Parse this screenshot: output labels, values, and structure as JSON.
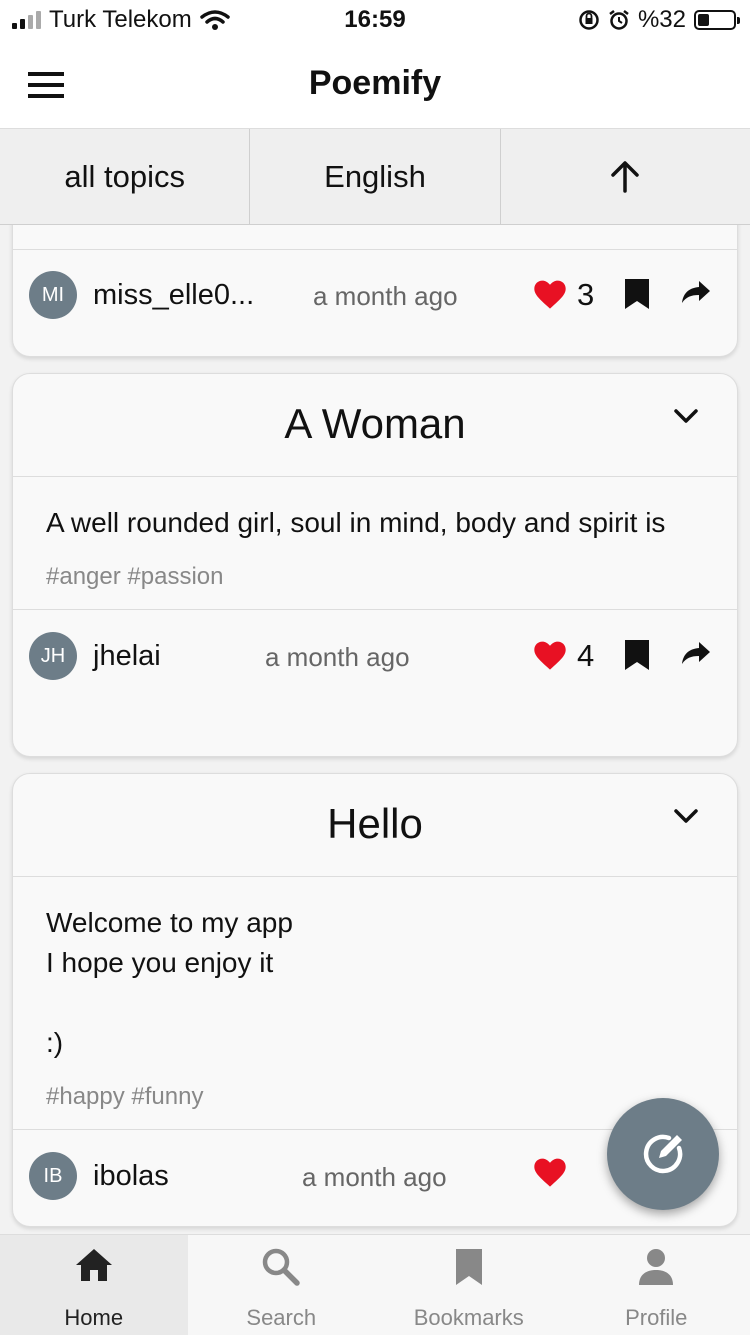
{
  "status_bar": {
    "carrier": "Turk Telekom",
    "time": "16:59",
    "battery_text": "%32",
    "battery_level": 0.32
  },
  "app": {
    "title": "Poemify"
  },
  "filters": {
    "topic": "all topics",
    "language": "English"
  },
  "posts": [
    {
      "author": "miss_elle0...",
      "initials": "MI",
      "time": "a month ago",
      "likes": "3"
    },
    {
      "title": "A Woman",
      "body": "A well rounded girl, soul in mind, body and spirit is",
      "tags": "#anger #passion",
      "author": "jhelai",
      "initials": "JH",
      "time": "a month ago",
      "likes": "4"
    },
    {
      "title": "Hello",
      "body": "Welcome to my app\nI hope you enjoy it\n\n:)",
      "tags": "#happy #funny",
      "author": "ibolas",
      "initials": "IB",
      "time": "a month ago"
    }
  ],
  "nav": {
    "home": "Home",
    "search": "Search",
    "bookmarks": "Bookmarks",
    "profile": "Profile"
  },
  "colors": {
    "like": "#e81123",
    "avatar": "#6d7d88",
    "fab": "#6d7d88"
  }
}
